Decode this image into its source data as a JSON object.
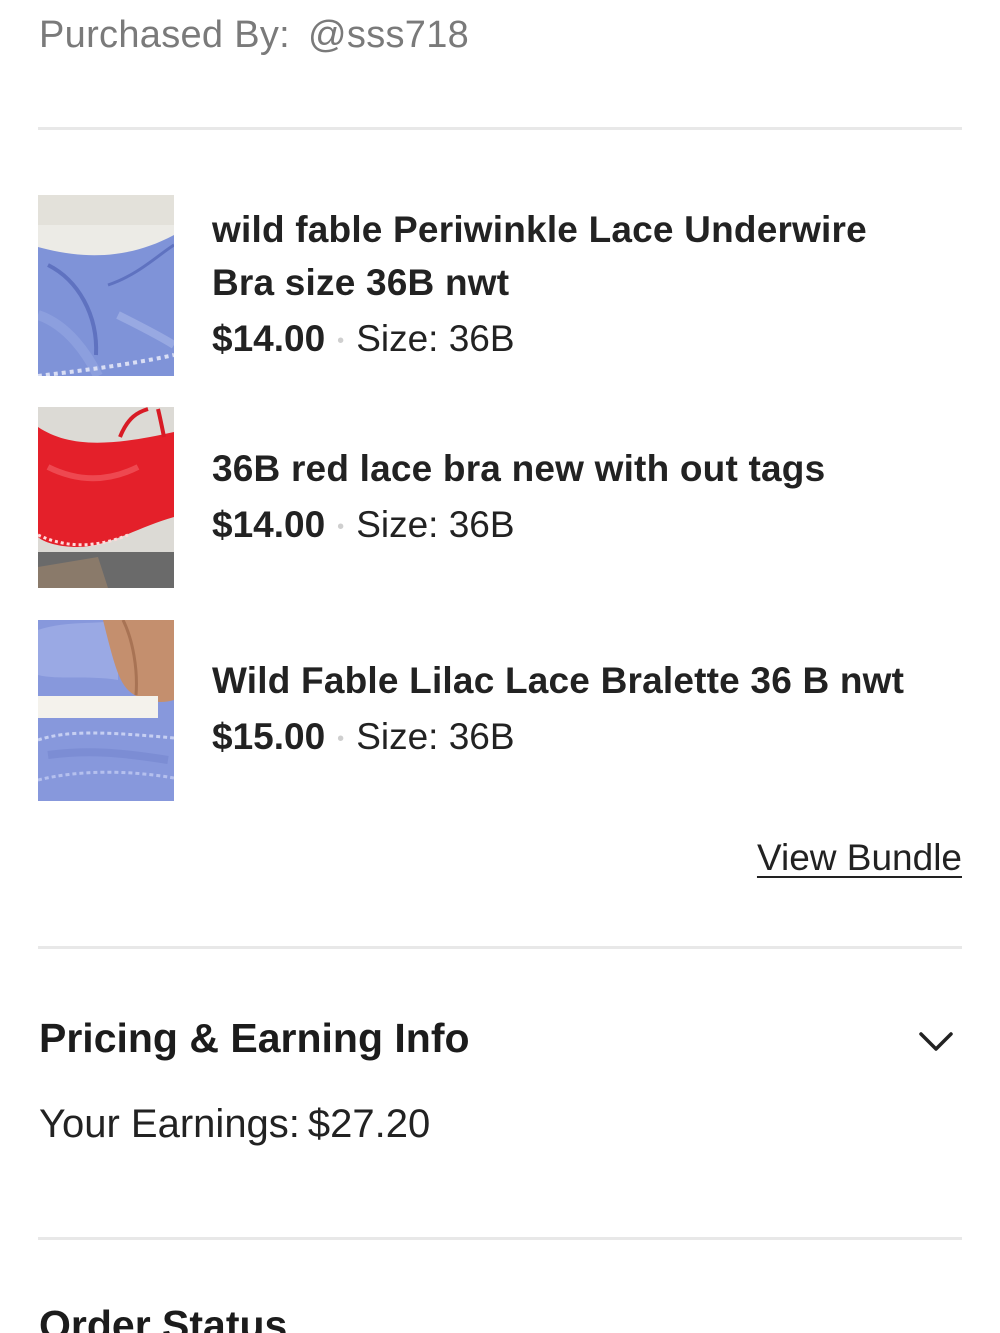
{
  "purchased": {
    "label": "Purchased By:",
    "username": "@sss718"
  },
  "items": [
    {
      "title_line1": "wild fable Periwinkle Lace Underwire",
      "title_line2": "Bra size 36B nwt",
      "price": "$14.00",
      "size": "Size: 36B",
      "thumbnail": "periwinkle-lace-bra-photo"
    },
    {
      "title_line1": "36B red lace bra new with out tags",
      "price": "$14.00",
      "size": "Size: 36B",
      "thumbnail": "red-lace-bra-photo"
    },
    {
      "title_line1": "Wild Fable Lilac Lace Bralette 36 B nwt",
      "price": "$15.00",
      "size": "Size: 36B",
      "thumbnail": "lilac-lace-bralette-photo"
    }
  ],
  "meta_separator": "•",
  "view_bundle_label": "View Bundle",
  "pricing": {
    "title": "Pricing & Earning Info",
    "earnings_label": "Your Earnings:",
    "earnings_value": "$27.20",
    "toggle_icon": "chevron-down-icon"
  },
  "order_status": {
    "title": "Order Status"
  },
  "colors": {
    "text": "#222222",
    "muted": "#7a7a7a",
    "divider": "#e8e8e8",
    "periwinkle": "#7f93d8",
    "red_lace": "#e4202a"
  }
}
